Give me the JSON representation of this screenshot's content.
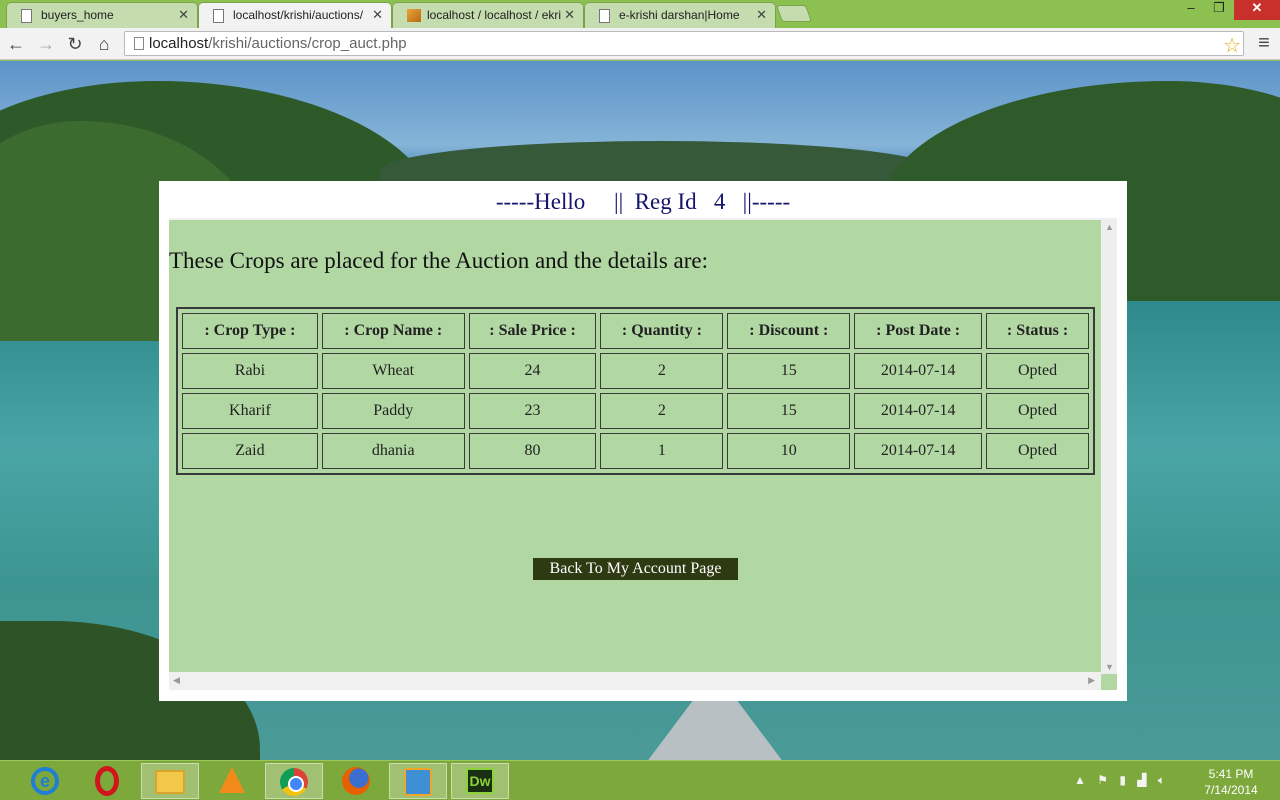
{
  "browser": {
    "tabs": [
      {
        "title": "buyers_home",
        "icon": "page-icon",
        "active": false
      },
      {
        "title": "localhost/krishi/auctions/",
        "icon": "page-icon",
        "active": true
      },
      {
        "title": "localhost / localhost / ekri",
        "icon": "phpmyadmin-icon",
        "active": false
      },
      {
        "title": "e-krishi darshan|Home",
        "icon": "page-icon",
        "active": false
      }
    ],
    "close_glyph": "✕",
    "url_host": "localhost",
    "url_path": "/krishi/auctions/crop_auct.php",
    "window_controls": {
      "minimize": "–",
      "maximize": "❐",
      "close": "✕"
    },
    "nav": {
      "back": "←",
      "forward": "→",
      "reload": "↻",
      "home": "⌂",
      "menu": "≡",
      "star": "☆"
    }
  },
  "page": {
    "greeting": "-----Hello     ||  Reg Id   4   ||-----",
    "intro": "These Crops are placed for the Auction and the details are:",
    "table": {
      "headers": [
        ": Crop Type :",
        ": Crop Name :",
        ": Sale Price :",
        ": Quantity :",
        ": Discount :",
        ": Post Date :",
        ": Status :"
      ],
      "rows": [
        [
          "Rabi",
          "Wheat",
          "24",
          "2",
          "15",
          "2014-07-14",
          "Opted"
        ],
        [
          "Kharif",
          "Paddy",
          "23",
          "2",
          "15",
          "2014-07-14",
          "Opted"
        ],
        [
          "Zaid",
          "dhania",
          "80",
          "1",
          "10",
          "2014-07-14",
          "Opted"
        ]
      ]
    },
    "back_button": "Back To My Account Page",
    "colors": {
      "content_bg": "#b1d8a3",
      "greeting": "#14146a",
      "button_bg": "#2e3a12"
    }
  },
  "taskbar": {
    "apps": [
      "internet-explorer",
      "opera",
      "file-explorer",
      "vlc",
      "chrome",
      "firefox",
      "media-player",
      "dreamweaver"
    ],
    "active_app": "chrome",
    "dreamweaver_label": "Dw",
    "ie_label": "e",
    "tray_up": "▲",
    "time": "5:41 PM",
    "date": "7/14/2014"
  }
}
